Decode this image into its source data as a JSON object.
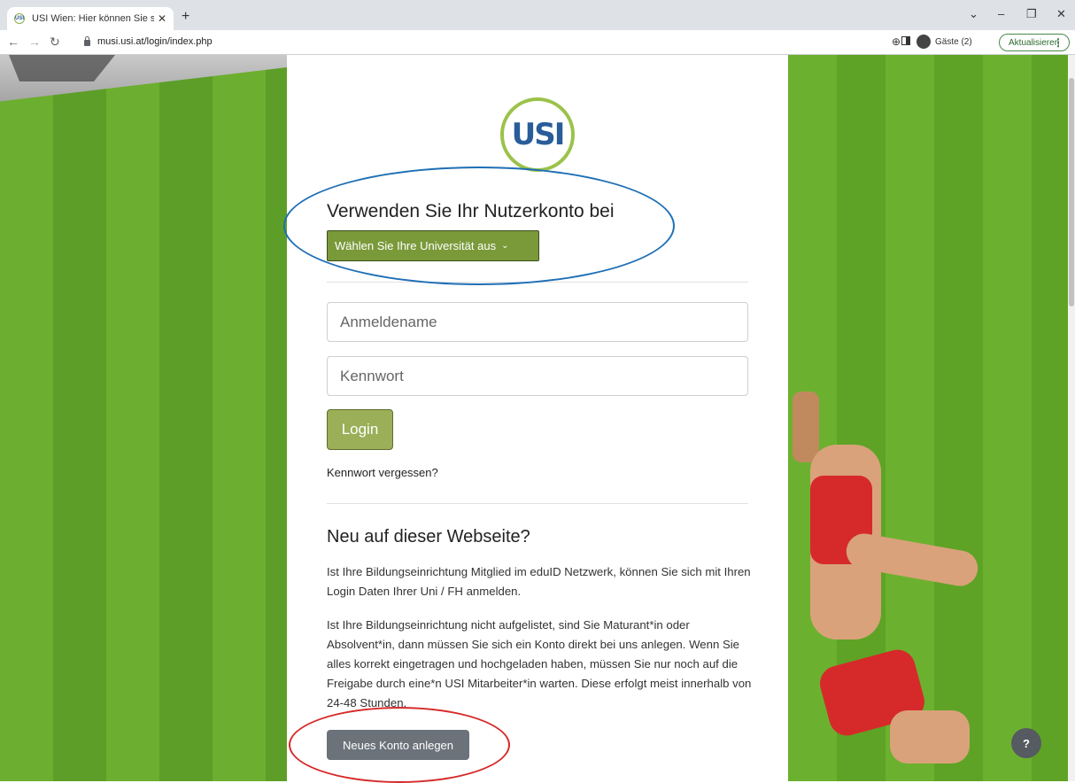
{
  "browser": {
    "tab_title": "USI Wien: Hier können Sie sich a",
    "tab_close": "✕",
    "new_tab": "+",
    "url": "musi.usi.at/login/index.php",
    "profile_label": "Gäste (2)",
    "update_label": "Aktualisieren",
    "window_controls": [
      "⌄",
      "–",
      "❐",
      "✕"
    ]
  },
  "logo": {
    "text": "USI"
  },
  "login": {
    "use_account_heading": "Verwenden Sie Ihr Nutzerkonto bei",
    "university_select": "Wählen Sie Ihre Universität aus",
    "username_placeholder": "Anmeldename",
    "password_placeholder": "Kennwort",
    "login_button": "Login",
    "forgot_link": "Kennwort vergessen?"
  },
  "signup": {
    "heading": "Neu auf dieser Webseite?",
    "paragraph1": "Ist Ihre Bildungseinrichtung Mitglied im eduID Netzwerk, können Sie sich mit Ihren Login Daten Ihrer Uni / FH anmelden.",
    "paragraph2": "Ist Ihre Bildungseinrichtung nicht aufgelistet, sind Sie Maturant*in oder Absolvent*in, dann müssen Sie sich ein Konto direkt bei uns anlegen. Wenn Sie alles korrekt eingetragen und hochgeladen haben, müssen Sie nur noch auf die Freigabe durch eine*n USI Mitarbeiter*in warten. Diese erfolgt meist innerhalb von 24-48 Stunden.",
    "new_account_button": "Neues Konto anlegen"
  },
  "help_button": "?",
  "colors": {
    "accent_green": "#7a9a3a",
    "login_green": "#9aaf57",
    "annotation_blue": "#1e6fb5",
    "annotation_red": "#d62a2a"
  }
}
